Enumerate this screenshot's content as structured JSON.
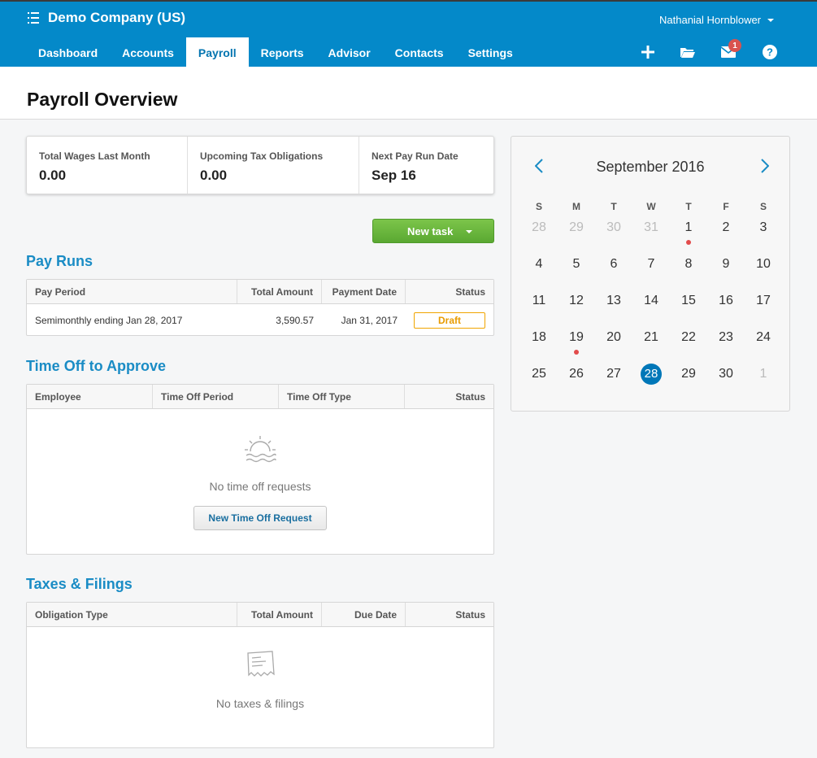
{
  "header": {
    "org_name": "Demo Company (US)",
    "user_name": "Nathanial Hornblower",
    "mail_badge": "1",
    "nav_tabs": [
      "Dashboard",
      "Accounts",
      "Payroll",
      "Reports",
      "Advisor",
      "Contacts",
      "Settings"
    ],
    "active_tab": "Payroll",
    "icons": [
      "plus-icon",
      "folder-icon",
      "mail-icon",
      "help-icon"
    ]
  },
  "page": {
    "title": "Payroll Overview"
  },
  "summary": [
    {
      "label": "Total Wages Last Month",
      "value": "0.00"
    },
    {
      "label": "Upcoming Tax Obligations",
      "value": "0.00"
    },
    {
      "label": "Next Pay Run Date",
      "value": "Sep 16"
    }
  ],
  "actions": {
    "new_task_label": "New task"
  },
  "pay_runs": {
    "title": "Pay Runs",
    "columns": [
      "Pay Period",
      "Total Amount",
      "Payment Date",
      "Status"
    ],
    "rows": [
      {
        "period": "Semimonthly ending Jan 28, 2017",
        "amount": "3,590.57",
        "date": "Jan 31, 2017",
        "status": "Draft"
      }
    ]
  },
  "time_off": {
    "title": "Time Off to Approve",
    "columns": [
      "Employee",
      "Time Off Period",
      "Time Off Type",
      "Status"
    ],
    "empty_text": "No time off requests",
    "button_label": "New Time Off Request"
  },
  "taxes": {
    "title": "Taxes & Filings",
    "columns": [
      "Obligation Type",
      "Total Amount",
      "Due Date",
      "Status"
    ],
    "empty_text": "No taxes & filings"
  },
  "calendar": {
    "title": "September 2016",
    "weekdays": [
      "S",
      "M",
      "T",
      "W",
      "T",
      "F",
      "S"
    ],
    "weeks": [
      [
        "28",
        "29",
        "30",
        "31",
        "1",
        "2",
        "3"
      ],
      [
        "4",
        "5",
        "6",
        "7",
        "8",
        "9",
        "10"
      ],
      [
        "11",
        "12",
        "13",
        "14",
        "15",
        "16",
        "17"
      ],
      [
        "18",
        "19",
        "20",
        "21",
        "22",
        "23",
        "24"
      ],
      [
        "25",
        "26",
        "27",
        "28",
        "29",
        "30",
        "1"
      ]
    ],
    "muted": [
      [
        0,
        0
      ],
      [
        0,
        1
      ],
      [
        0,
        2
      ],
      [
        0,
        3
      ],
      [
        4,
        6
      ]
    ],
    "today": [
      4,
      3
    ],
    "events": [
      [
        0,
        4
      ],
      [
        3,
        1
      ]
    ],
    "colors": {
      "accent": "#0489c9",
      "today": "#0077b8",
      "event": "#e24b4b"
    }
  }
}
